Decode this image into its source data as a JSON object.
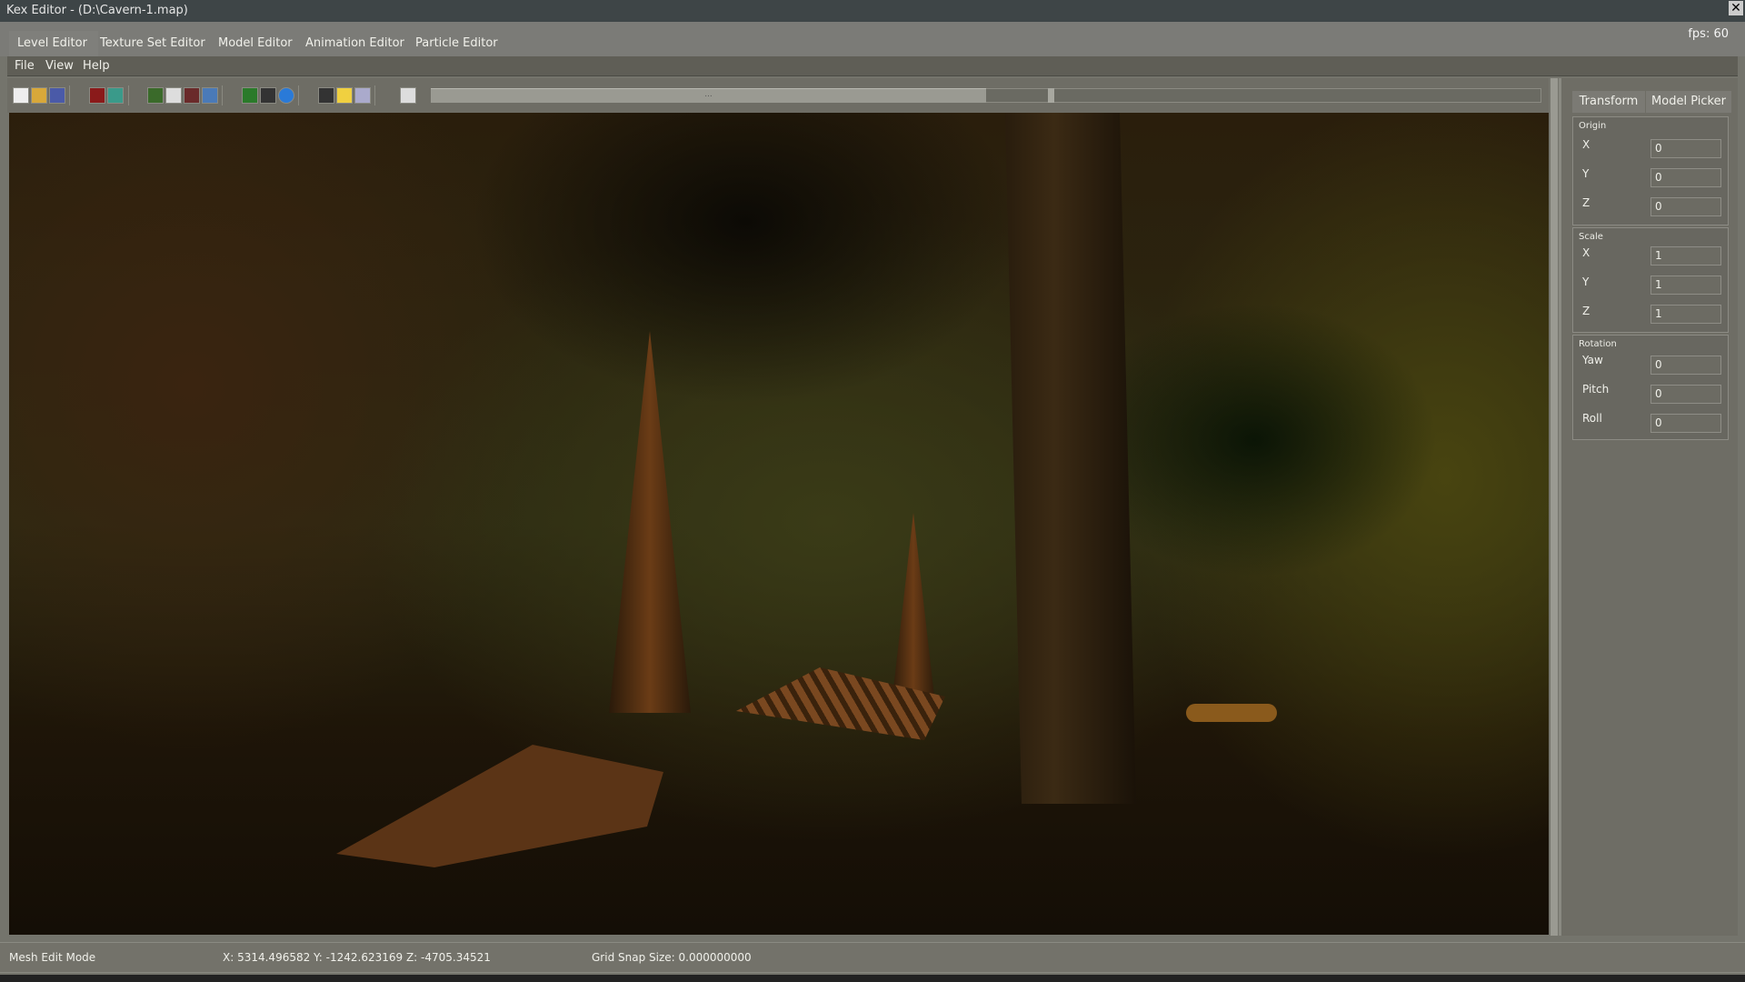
{
  "window": {
    "title": "Kex Editor - (D:\\Cavern-1.map)",
    "close": "✕",
    "fps": "fps: 60"
  },
  "editor_tabs": [
    "Level Editor",
    "Texture Set Editor",
    "Model Editor",
    "Animation Editor",
    "Particle Editor"
  ],
  "menu": [
    "File",
    "View",
    "Help"
  ],
  "toolbar": {
    "icons": [
      "new-file",
      "open-folder",
      "save",
      "cube",
      "picture",
      "no-tree",
      "window",
      "delete-box",
      "delete-sphere",
      "tree",
      "stairs",
      "arrow-circle",
      "export",
      "sun",
      "grid-layout",
      "grid"
    ],
    "scroll_grip": "..."
  },
  "side_panel": {
    "tabs": [
      "Transform",
      "Model Picker"
    ],
    "groups": [
      {
        "title": "Origin",
        "fields": [
          {
            "label": "X",
            "value": "0"
          },
          {
            "label": "Y",
            "value": "0"
          },
          {
            "label": "Z",
            "value": "0"
          }
        ]
      },
      {
        "title": "Scale",
        "fields": [
          {
            "label": "X",
            "value": "1"
          },
          {
            "label": "Y",
            "value": "1"
          },
          {
            "label": "Z",
            "value": "1"
          }
        ]
      },
      {
        "title": "Rotation",
        "fields": [
          {
            "label": "Yaw",
            "value": "0"
          },
          {
            "label": "Pitch",
            "value": "0"
          },
          {
            "label": "Roll",
            "value": "0"
          }
        ]
      }
    ]
  },
  "status": {
    "mode": "Mesh Edit Mode",
    "coords": "X: 5314.496582 Y: -1242.623169 Z: -4705.34521",
    "grid": "Grid Snap Size: 0.000000000"
  }
}
